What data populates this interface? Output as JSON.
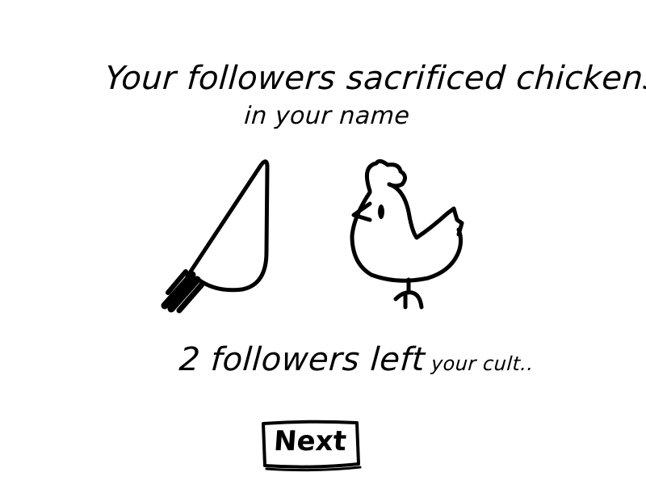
{
  "screen": {
    "title_line1": "Your followers sacrificed chickens",
    "title_line2": "in your name",
    "result_main": "2 followers left",
    "result_small": " your cult..",
    "next_label": "Next"
  },
  "icons": [
    "knife-icon",
    "chicken-icon"
  ],
  "colors": {
    "background": "#ffffff",
    "ink": "#000000"
  }
}
